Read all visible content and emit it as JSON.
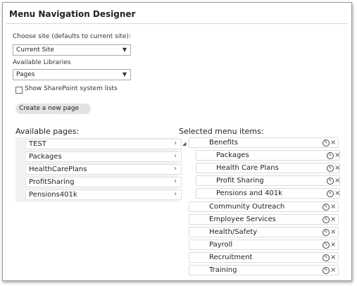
{
  "title": "Menu Navigation Designer",
  "site": {
    "label": "Choose site (defaults to current site):",
    "value": "Current Site"
  },
  "libraries": {
    "label": "Available Libraries",
    "value": "Pages"
  },
  "show_system_lists": {
    "label": "Show SharePoint system lists",
    "checked": false
  },
  "create_page_button": "Create a new page",
  "available_pages": {
    "title": "Available pages:",
    "items": [
      "TEST",
      "Packages",
      "HealthCarePlans",
      "ProfitSharing",
      "Pensions401k"
    ]
  },
  "selected_menu": {
    "title": "Selected menu items:",
    "parent": "Benefits",
    "children": [
      "Packages",
      "Health Care Plans",
      "Profit Sharing",
      "Pensions and 401k"
    ],
    "top_level": [
      "Community Outreach",
      "Employee Services",
      "Health/Safety",
      "Payroll",
      "Recruitment",
      "Training"
    ]
  },
  "icons": {
    "dropdown": "chevron-down-icon",
    "page_item": "chevron-right-icon",
    "edit": "edit-icon",
    "delete": "close-icon",
    "expand": "expand-triangle-icon"
  }
}
